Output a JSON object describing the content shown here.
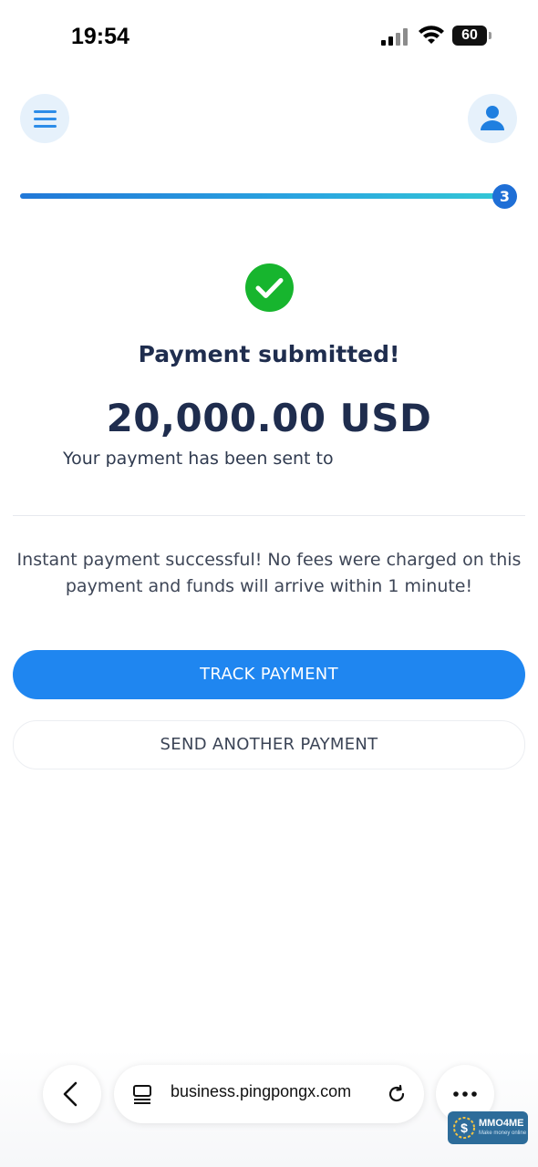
{
  "status_bar": {
    "time": "19:54",
    "battery": "60"
  },
  "header": {
    "menu_icon": "hamburger-menu-icon",
    "profile_icon": "user-icon"
  },
  "progress": {
    "step": "3",
    "fraction": 1.0
  },
  "result": {
    "title": "Payment submitted!",
    "amount": "20,000.00 USD",
    "sent_to": "Your payment has been sent to",
    "notice": "Instant payment successful! No fees were charged on this payment and funds will arrive within 1 minute!"
  },
  "actions": {
    "track": "TRACK PAYMENT",
    "send_another": "SEND ANOTHER PAYMENT"
  },
  "browser": {
    "url": "business.pingpongx.com"
  },
  "watermark": {
    "title": "MMO4ME",
    "subtitle": "Make money online"
  },
  "colors": {
    "primary": "#1f86f0",
    "success": "#17b52e",
    "text": "#1f2d4e"
  }
}
